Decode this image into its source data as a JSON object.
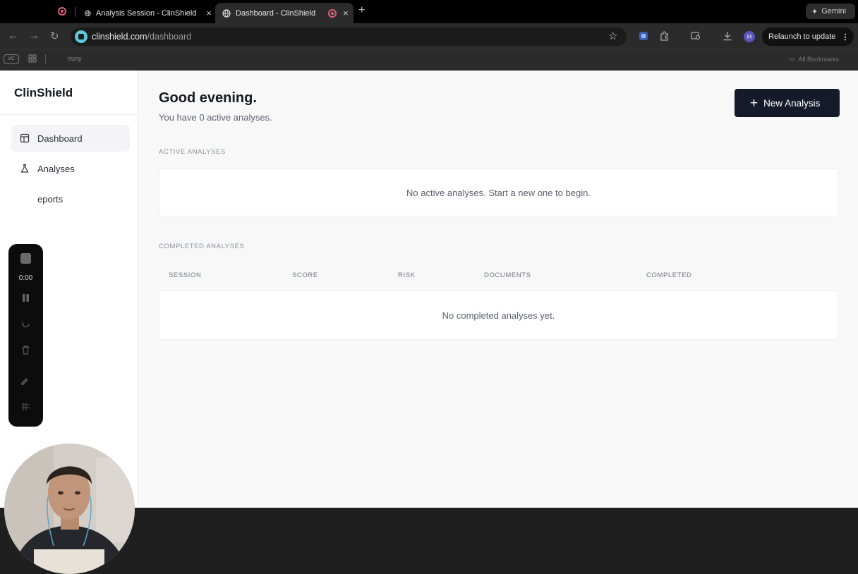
{
  "browser": {
    "tabs": [
      {
        "title": "Analysis Session - ClinShield",
        "close": "×"
      },
      {
        "title": "Dashboard - ClinShield",
        "close": "×"
      }
    ],
    "new_tab": "+",
    "gemini_label": "Gemini",
    "url_domain": "clinshield.com",
    "url_path": "/dashboard",
    "profile_initial": "H",
    "relaunch_label": "Relaunch to update",
    "bookmarks": {
      "vc_label": "VC",
      "item": "ouny",
      "all_label": "All Bookmarks"
    }
  },
  "app": {
    "brand": "ClinShield",
    "nav": [
      {
        "label": "Dashboard",
        "icon": "dashboard-icon",
        "active": true
      },
      {
        "label": "Analyses",
        "icon": "flask-icon",
        "active": false
      },
      {
        "label": "eports",
        "icon": "reports-icon",
        "active": false
      }
    ],
    "greeting": "Good evening.",
    "subtitle": "You have 0 active analyses.",
    "new_button": "New Analysis",
    "active_section": {
      "label": "ACTIVE ANALYSES",
      "empty_text": "No active analyses. Start a new one to begin."
    },
    "completed_section": {
      "label": "COMPLETED ANALYSES",
      "columns": [
        "SESSION",
        "SCORE",
        "RISK",
        "DOCUMENTS",
        "COMPLETED"
      ],
      "empty_text": "No completed analyses yet."
    }
  },
  "recorder": {
    "time": "0:00"
  },
  "colors": {
    "primary_button": "#141a29",
    "page_background": "#f8f8f9",
    "recording_indicator": "#e0607a"
  }
}
